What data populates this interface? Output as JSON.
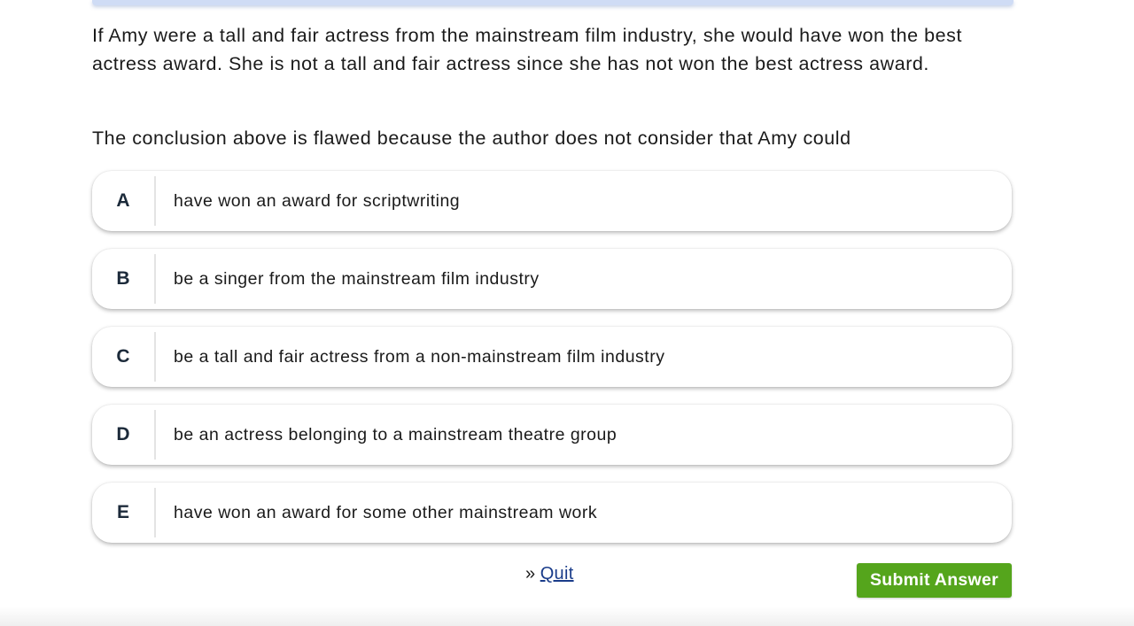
{
  "passage": "If Amy were a tall and fair actress from the mainstream film industry, she would have won the best actress award. She is not a tall and fair actress since she has not won the best actress award.",
  "question": "The conclusion above is flawed because the author does not consider that Amy could",
  "options": [
    {
      "letter": "A",
      "text": "have won an award for scriptwriting"
    },
    {
      "letter": "B",
      "text": "be a singer from the mainstream film industry"
    },
    {
      "letter": "C",
      "text": "be a tall and fair actress from a non-mainstream film industry"
    },
    {
      "letter": "D",
      "text": "be an actress belonging to a mainstream theatre group"
    },
    {
      "letter": "E",
      "text": "have won an award for some other mainstream work"
    }
  ],
  "footer": {
    "quit_prefix": "»",
    "quit_label": "Quit",
    "submit_label": "Submit Answer"
  },
  "colors": {
    "submit_button": "#55a51c",
    "quit_link": "#1a3c8a",
    "option_letter": "#1c2a3a"
  }
}
